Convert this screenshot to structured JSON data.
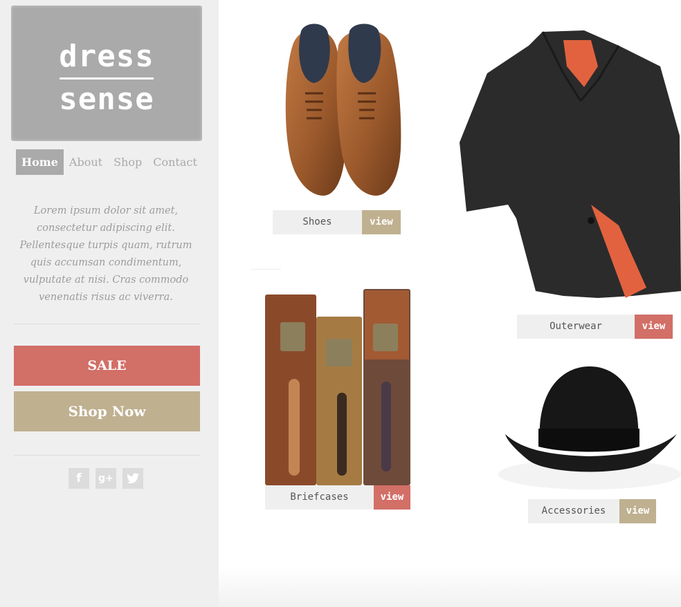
{
  "brand": {
    "line1": "dress",
    "line2": "sense"
  },
  "nav": {
    "items": [
      {
        "label": "Home",
        "active": true
      },
      {
        "label": "About",
        "active": false
      },
      {
        "label": "Shop",
        "active": false
      },
      {
        "label": "Contact",
        "active": false
      }
    ]
  },
  "intro_text": "Lorem ipsum dolor sit amet, consectetur adipiscing elit. Pellentesque turpis quam, rutrum quis accumsan condimentum, vulputate at nisi. Cras commodo venenatis risus ac viverra.",
  "buttons": {
    "sale": "SALE",
    "shop_now": "Shop Now"
  },
  "social": [
    {
      "icon": "facebook-icon",
      "glyph": "f"
    },
    {
      "icon": "google-plus-icon",
      "glyph": "g+"
    },
    {
      "icon": "twitter-icon",
      "glyph": "t"
    }
  ],
  "products": [
    {
      "label": "Shoes",
      "view_label": "view",
      "view_color": "#bfb090",
      "icon": "shoes-image"
    },
    {
      "label": "Outerwear",
      "view_label": "view",
      "view_color": "#d26f67",
      "icon": "coat-image"
    },
    {
      "label": "Briefcases",
      "view_label": "view",
      "view_color": "#d26f67",
      "icon": "briefcases-image"
    },
    {
      "label": "Accessories",
      "view_label": "view",
      "view_color": "#bfb090",
      "icon": "bowler-hat-image"
    }
  ],
  "colors": {
    "sidebar_bg": "#efefef",
    "logo_bg": "#a9aaa9",
    "accent_red": "#d26f67",
    "accent_tan": "#bfb090",
    "text_grey": "#9c9c9c"
  }
}
